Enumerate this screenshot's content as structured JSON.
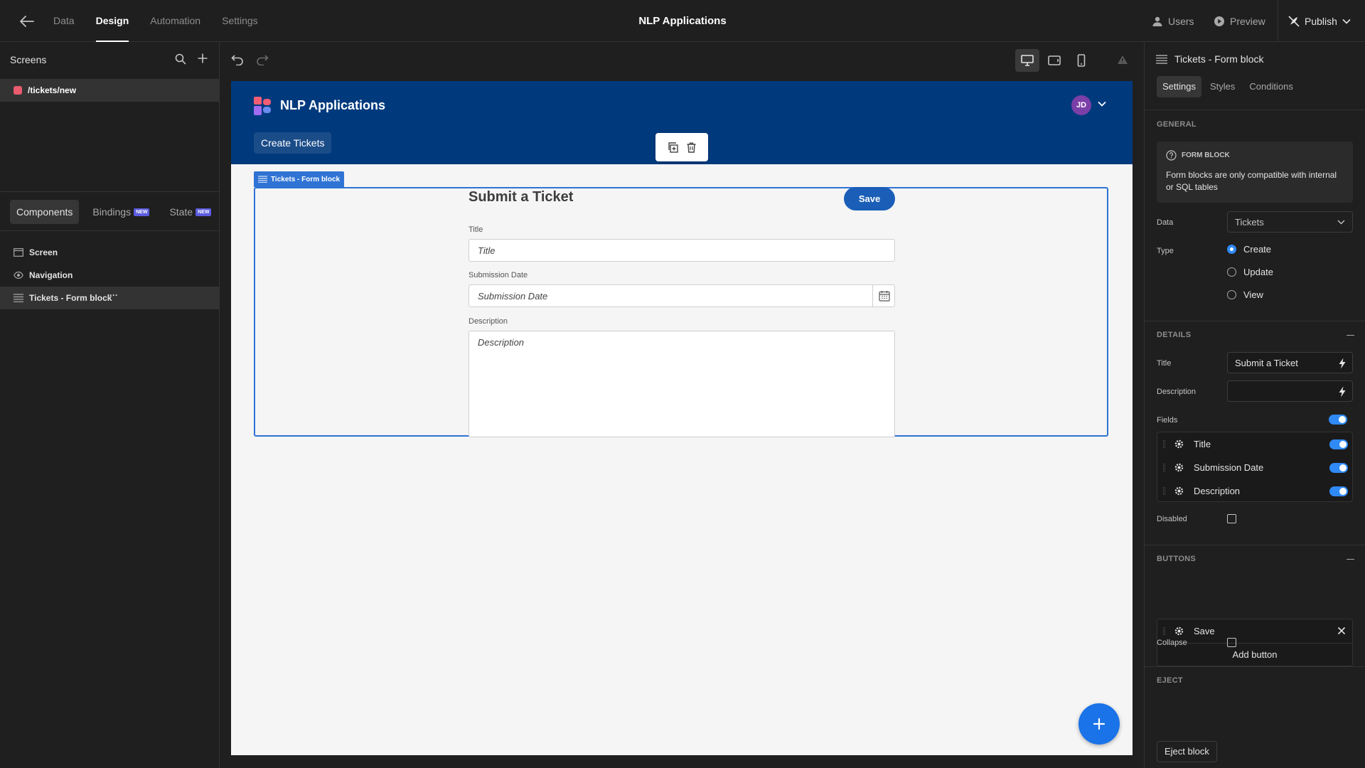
{
  "topbar": {
    "back_icon": "arrow-left-icon",
    "tabs": [
      {
        "label": "Data"
      },
      {
        "label": "Design"
      },
      {
        "label": "Automation"
      },
      {
        "label": "Settings"
      }
    ],
    "active_tab": "Design",
    "app_title": "NLP Applications",
    "users_label": "Users",
    "preview_label": "Preview",
    "publish_label": "Publish"
  },
  "left": {
    "screens_title": "Screens",
    "screen_route": "/tickets/new",
    "tabs": {
      "components": "Components",
      "bindings": "Bindings",
      "state": "State",
      "new_badge": "NEW"
    },
    "tree": [
      {
        "label": "Screen"
      },
      {
        "label": "Navigation"
      },
      {
        "label": "Tickets - Form block"
      }
    ],
    "more": "···"
  },
  "canvas": {
    "app_name": "NLP Applications",
    "avatar_initials": "JD",
    "nav_link": "Create Tickets",
    "form_block_label": "Tickets - Form block",
    "form_title": "Submit a Ticket",
    "save_label": "Save",
    "fields": {
      "title_label": "Title",
      "title_placeholder": "Title",
      "date_label": "Submission Date",
      "date_placeholder": "Submission Date",
      "desc_label": "Description",
      "desc_placeholder": "Description"
    }
  },
  "right": {
    "header": "Tickets - Form block",
    "tabs": {
      "settings": "Settings",
      "styles": "Styles",
      "conditions": "Conditions"
    },
    "general": {
      "section": "GENERAL",
      "info_title": "FORM BLOCK",
      "info_body": "Form blocks are only compatible with internal or SQL tables",
      "data_label": "Data",
      "data_value": "Tickets",
      "type_label": "Type",
      "types": [
        "Create",
        "Update",
        "View"
      ],
      "selected_type": "Create"
    },
    "details": {
      "section": "DETAILS",
      "title_label": "Title",
      "title_value": "Submit a Ticket",
      "description_label": "Description",
      "description_value": "",
      "fields_label": "Fields",
      "fields": [
        "Title",
        "Submission Date",
        "Description"
      ],
      "disabled_label": "Disabled"
    },
    "buttons": {
      "section": "BUTTONS",
      "items": [
        "Save"
      ],
      "add_button": "Add button",
      "collapse_label": "Collapse"
    },
    "eject": {
      "section": "EJECT",
      "button": "Eject block"
    }
  },
  "colors": {
    "nav_bg": "#003a7d",
    "accent": "#2f73d4",
    "save_button": "#1a5eb7",
    "fab": "#1a73e8",
    "toggle_on": "#2f8af5",
    "screen_dot": "#ea5b6d"
  }
}
